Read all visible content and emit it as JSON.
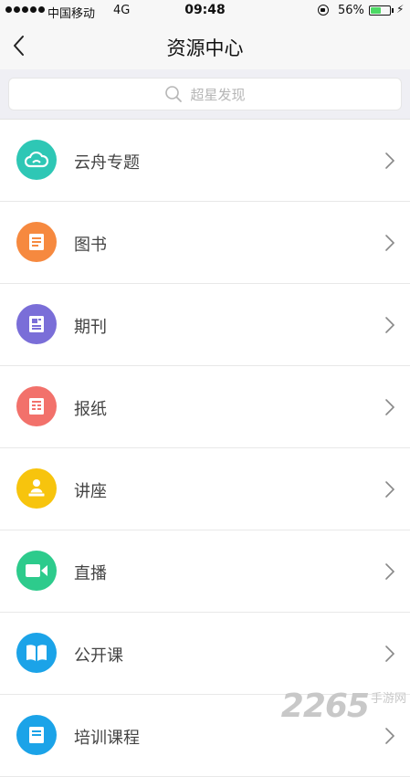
{
  "status_bar": {
    "carrier": "中国移动",
    "network": "4G",
    "time": "09:48",
    "battery_percent": "56%",
    "battery_level": 0.56,
    "battery_color": "#4cd964"
  },
  "nav": {
    "title": "资源中心",
    "back_icon": "chevron-left-icon"
  },
  "search": {
    "placeholder": "超星发现",
    "icon": "search-icon"
  },
  "list": [
    {
      "label": "云舟专题",
      "icon": "cloud-icon",
      "color": "#2ec7b5"
    },
    {
      "label": "图书",
      "icon": "book-icon",
      "color": "#f6893f"
    },
    {
      "label": "期刊",
      "icon": "journal-icon",
      "color": "#7a6ed8"
    },
    {
      "label": "报纸",
      "icon": "newspaper-icon",
      "color": "#f2716b"
    },
    {
      "label": "讲座",
      "icon": "lecture-icon",
      "color": "#f7c40d"
    },
    {
      "label": "直播",
      "icon": "video-icon",
      "color": "#2dcb8c"
    },
    {
      "label": "公开课",
      "icon": "open-book-icon",
      "color": "#1ba3e8"
    },
    {
      "label": "培训课程",
      "icon": "training-icon",
      "color": "#1ba3e8"
    }
  ],
  "watermark": {
    "number": "2265",
    "text": "手游网"
  }
}
